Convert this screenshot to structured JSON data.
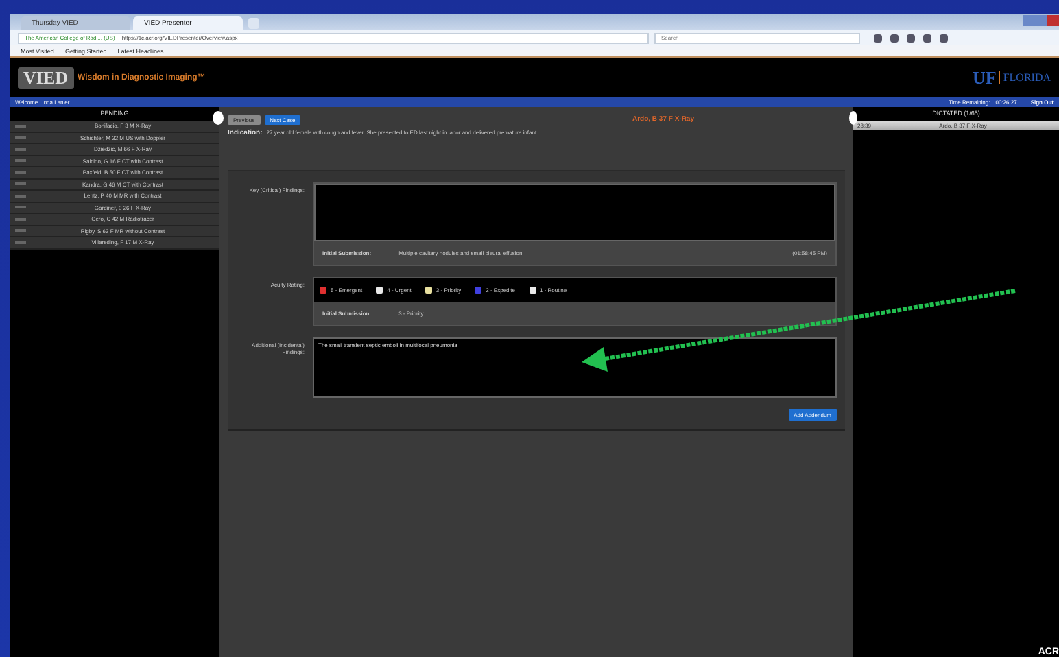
{
  "browser": {
    "tabs": [
      {
        "label": "Thursday VIED",
        "selected": false
      },
      {
        "label": "VIED Presenter",
        "selected": true
      }
    ],
    "site_identity": "The American College of Radi... (US)",
    "url": "https://1c.acr.org/VIEDPresenter/Overview.aspx",
    "search": {
      "placeholder": "Search"
    },
    "bookmarks": [
      "Most Visited",
      "Getting Started",
      "Latest Headlines"
    ]
  },
  "header": {
    "logo": "VIED",
    "tagline": "Wisdom in Diagnostic Imaging™",
    "partner": "UF",
    "partner_name": "FLORIDA"
  },
  "user_bar": {
    "welcome": "Welcome Linda Lanier",
    "time_label": "Time Remaining:",
    "time": "00:26:27",
    "sign_out": "Sign Out"
  },
  "pending": {
    "title": "PENDING",
    "items": [
      {
        "label": "Bonifacio, F 3 M X-Ray"
      },
      {
        "label": "Schichter, M 32 M US with Doppler"
      },
      {
        "label": "Dziedzic, M 66 F X-Ray"
      },
      {
        "label": "Salcido, G 16 F CT with Contrast"
      },
      {
        "label": "Paxfeld, B 50 F CT with Contrast"
      },
      {
        "label": "Kandra, G 46 M CT with Contrast"
      },
      {
        "label": "Lentz, P 40 M MR with Contrast"
      },
      {
        "label": "Gardiner, 0 26 F X-Ray"
      },
      {
        "label": "Gero, C 42 M Radiotracer"
      },
      {
        "label": "Rigby, S 63 F MR without Contrast"
      },
      {
        "label": "Villareding, F 17 M X-Ray"
      }
    ]
  },
  "case": {
    "buttons": [
      {
        "label": "Previous",
        "disabled": true
      },
      {
        "label": "Next Case",
        "disabled": false
      }
    ],
    "title": "Ardo, B 37 F X-Ray",
    "indication_label": "Indication:",
    "indication": "27 year old female with cough and fever. She presented to ED last night in labor and delivered premature infant.",
    "key_findings": {
      "label": "Key (Critical) Findings:",
      "submission_label": "Initial Submission:",
      "submission": "Multiple cavitary nodules and small pleural effusion",
      "time": "(01:58:45 PM)"
    },
    "acuity": {
      "label": "Acuity Rating:",
      "options": [
        {
          "label": "5 - Emergent",
          "color": "#e03030",
          "selected": false
        },
        {
          "label": "4 - Urgent",
          "color": "#e8e8e8",
          "selected": false
        },
        {
          "label": "3 - Priority",
          "color": "#e8e0a0",
          "selected": false
        },
        {
          "label": "2 - Expedite",
          "color": "#4040e0",
          "selected": false
        },
        {
          "label": "1 - Routine",
          "color": "#e8e8e8",
          "selected": false
        }
      ],
      "submission_label": "Initial Submission:",
      "submission": "3 - Priority"
    },
    "additional": {
      "label": "Additional (Incidental) Findings:",
      "value": "The small transient septic emboli in multifocal pneumonia"
    },
    "add_button": "Add Addendum"
  },
  "dictated": {
    "title": "DICTATED (1/65)",
    "rows": [
      {
        "time": "28:39",
        "label": "Ardo, B 37 F X-Ray"
      }
    ]
  },
  "slide_mark": "ACR"
}
